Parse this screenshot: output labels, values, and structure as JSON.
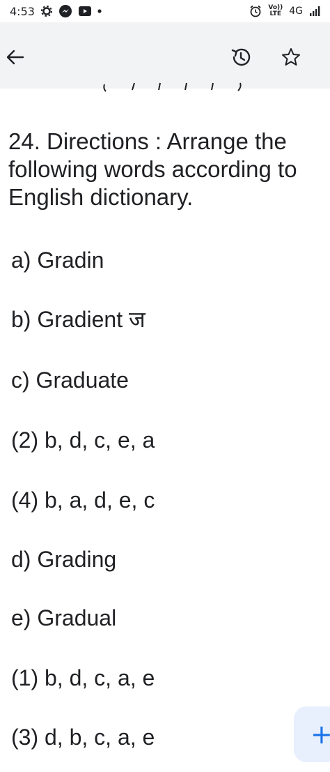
{
  "status_bar": {
    "time": "4:53",
    "network": "4G",
    "lte_top": "Vo))",
    "lte_bottom": "LTE",
    "left_icons": [
      "settings-icon",
      "messenger-icon",
      "youtube-icon",
      "notification-dot-icon"
    ],
    "right_icons": [
      "alarm-icon",
      "volte-icon",
      "signal-icon"
    ]
  },
  "toolbar": {
    "icons": [
      "back-arrow-icon",
      "history-icon",
      "star-icon"
    ]
  },
  "question": {
    "text": "24. Directions : Arrange the following words according to English dictionary."
  },
  "options": [
    {
      "label": "a) Gradin"
    },
    {
      "label": "b) Gradient ज"
    },
    {
      "label": "c) Graduate"
    },
    {
      "label": "(2) b, d, c, e, a"
    },
    {
      "label": "(4) b, a, d, e, c"
    },
    {
      "label": "d) Grading"
    },
    {
      "label": "e) Gradual"
    },
    {
      "label": "(1) b, d, c, a, e"
    },
    {
      "label": "(3) d, b, c, a, e"
    }
  ],
  "fab": {
    "label": "+"
  },
  "colors": {
    "toolbar_bg": "#f1f3f4",
    "text": "#202124",
    "fab_bg": "#e8f0fe",
    "fab_icon": "#1a73e8"
  }
}
